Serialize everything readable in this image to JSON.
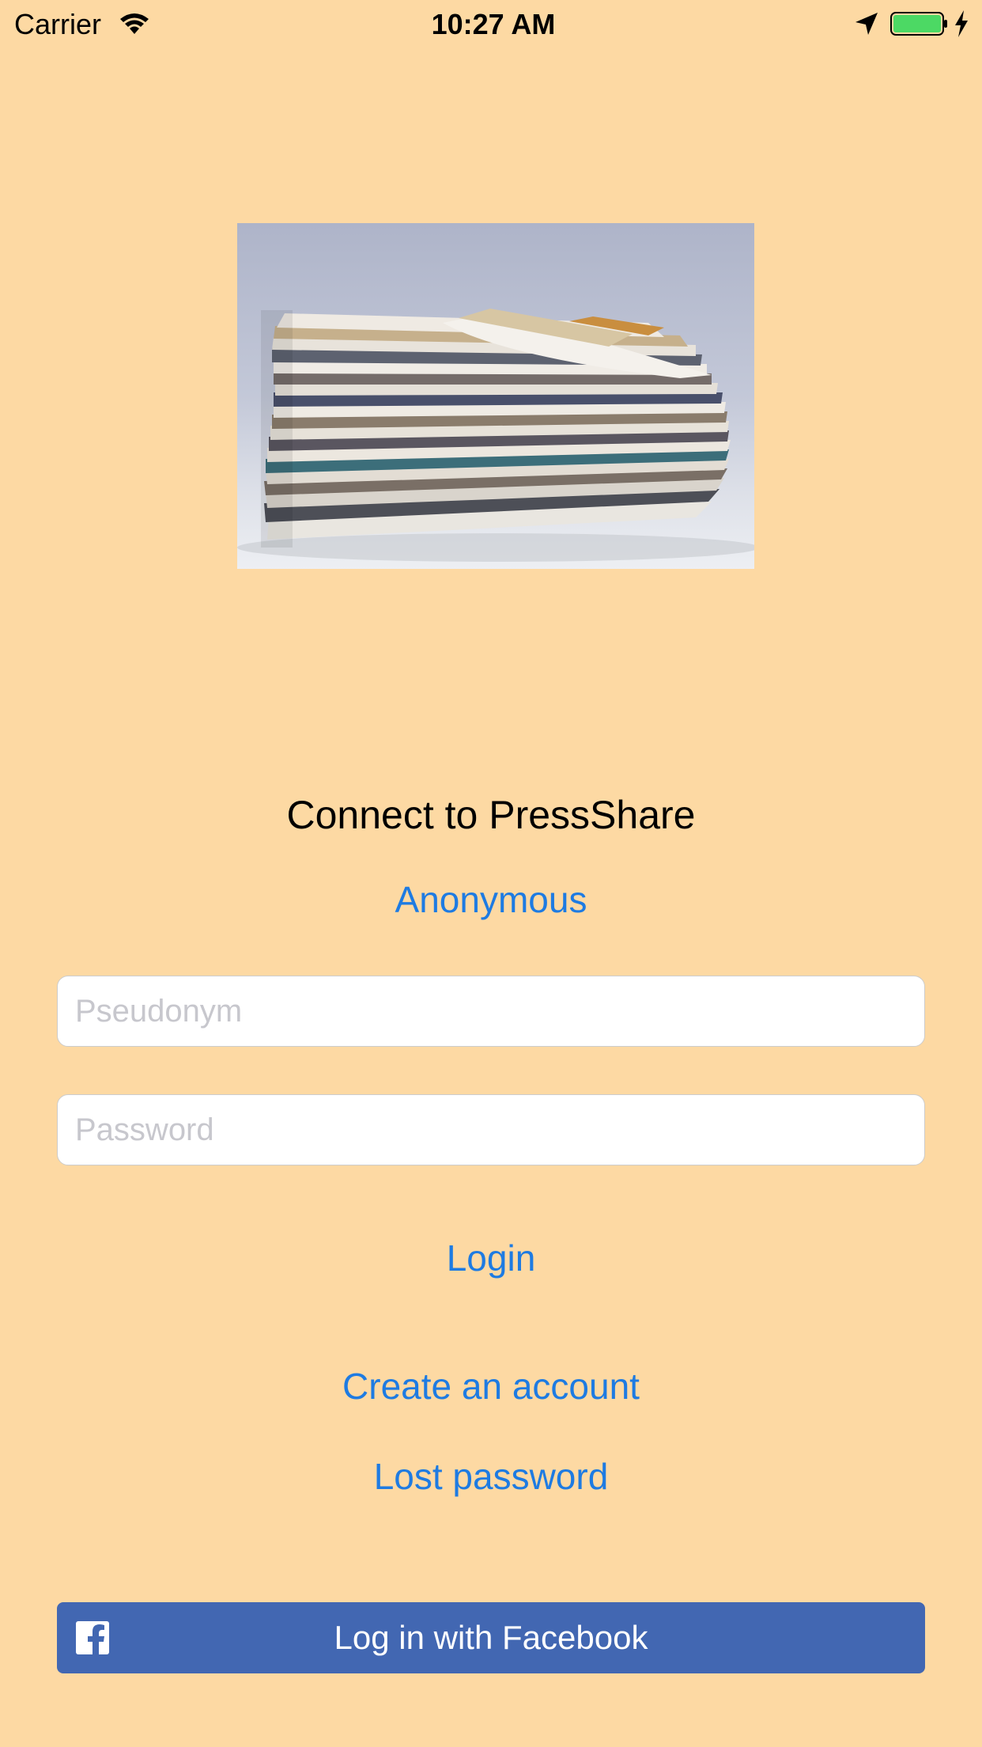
{
  "status_bar": {
    "carrier": "Carrier",
    "time": "10:27 AM",
    "battery_color": "#4CD964"
  },
  "hero": {
    "icon": "newspaper-stack-image"
  },
  "login": {
    "title": "Connect to PressShare",
    "anonymous_label": "Anonymous",
    "pseudonym_placeholder": "Pseudonym",
    "password_placeholder": "Password",
    "login_label": "Login",
    "create_account_label": "Create an account",
    "lost_password_label": "Lost password"
  },
  "facebook": {
    "label": "Log in with Facebook",
    "icon": "facebook-icon",
    "color": "#4267B2"
  },
  "colors": {
    "background": "#FDD9A3",
    "link": "#1E7BE2"
  }
}
